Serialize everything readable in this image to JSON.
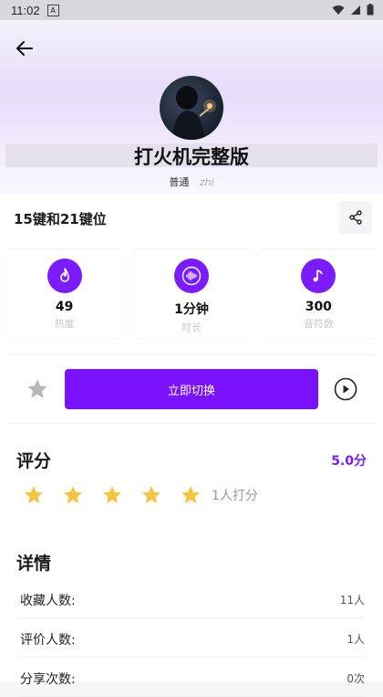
{
  "status_bar": {
    "time": "11:02",
    "badge": "A"
  },
  "header": {
    "title": "打火机完整版",
    "level": "普通",
    "extra": "zhi"
  },
  "info": {
    "key_title": "15键和21键位"
  },
  "stats": [
    {
      "icon": "flame-icon",
      "value": "49",
      "label": "热度"
    },
    {
      "icon": "waveform-icon",
      "value": "1分钟",
      "label": "时长"
    },
    {
      "icon": "music-note-icon",
      "value": "300",
      "label": "音符数"
    }
  ],
  "actions": {
    "switch_label": "立即切换"
  },
  "rating": {
    "title": "评分",
    "score": "5.0分",
    "stars": 5,
    "count_text": "1人打分"
  },
  "details": {
    "title": "详情",
    "rows": [
      {
        "key": "收藏人数:",
        "value": "11人"
      },
      {
        "key": "评价人数:",
        "value": "1人"
      },
      {
        "key": "分享次数:",
        "value": "0次"
      }
    ]
  },
  "colors": {
    "accent": "#7a1cff",
    "button": "#7a11ff",
    "star_active": "#f5c542"
  }
}
